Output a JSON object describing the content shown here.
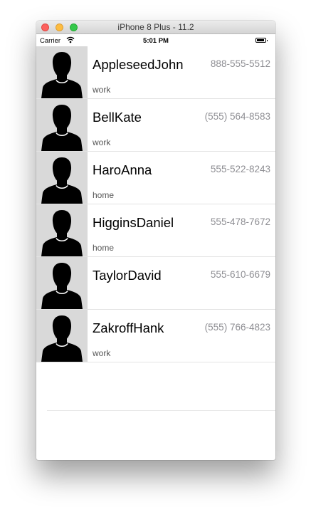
{
  "window": {
    "title": "iPhone 8 Plus - 11.2"
  },
  "statusbar": {
    "carrier": "Carrier",
    "time": "5:01 PM"
  },
  "contacts": [
    {
      "name": "AppleseedJohn",
      "phone": "888-555-5512",
      "label": "work"
    },
    {
      "name": "BellKate",
      "phone": "(555) 564-8583",
      "label": "work"
    },
    {
      "name": "HaroAnna",
      "phone": "555-522-8243",
      "label": "home"
    },
    {
      "name": "HigginsDaniel",
      "phone": "555-478-7672",
      "label": "home"
    },
    {
      "name": "TaylorDavid",
      "phone": "555-610-6679",
      "label": ""
    },
    {
      "name": "ZakroffHank",
      "phone": "(555) 766-4823",
      "label": "work"
    }
  ],
  "icons": {
    "avatar": "person-silhouette-icon",
    "wifi": "wifi-icon",
    "battery": "battery-icon"
  },
  "colors": {
    "avatar_bg": "#d9d9d9",
    "phone_text": "#8e8e93",
    "separator": "#e3e3e3"
  }
}
